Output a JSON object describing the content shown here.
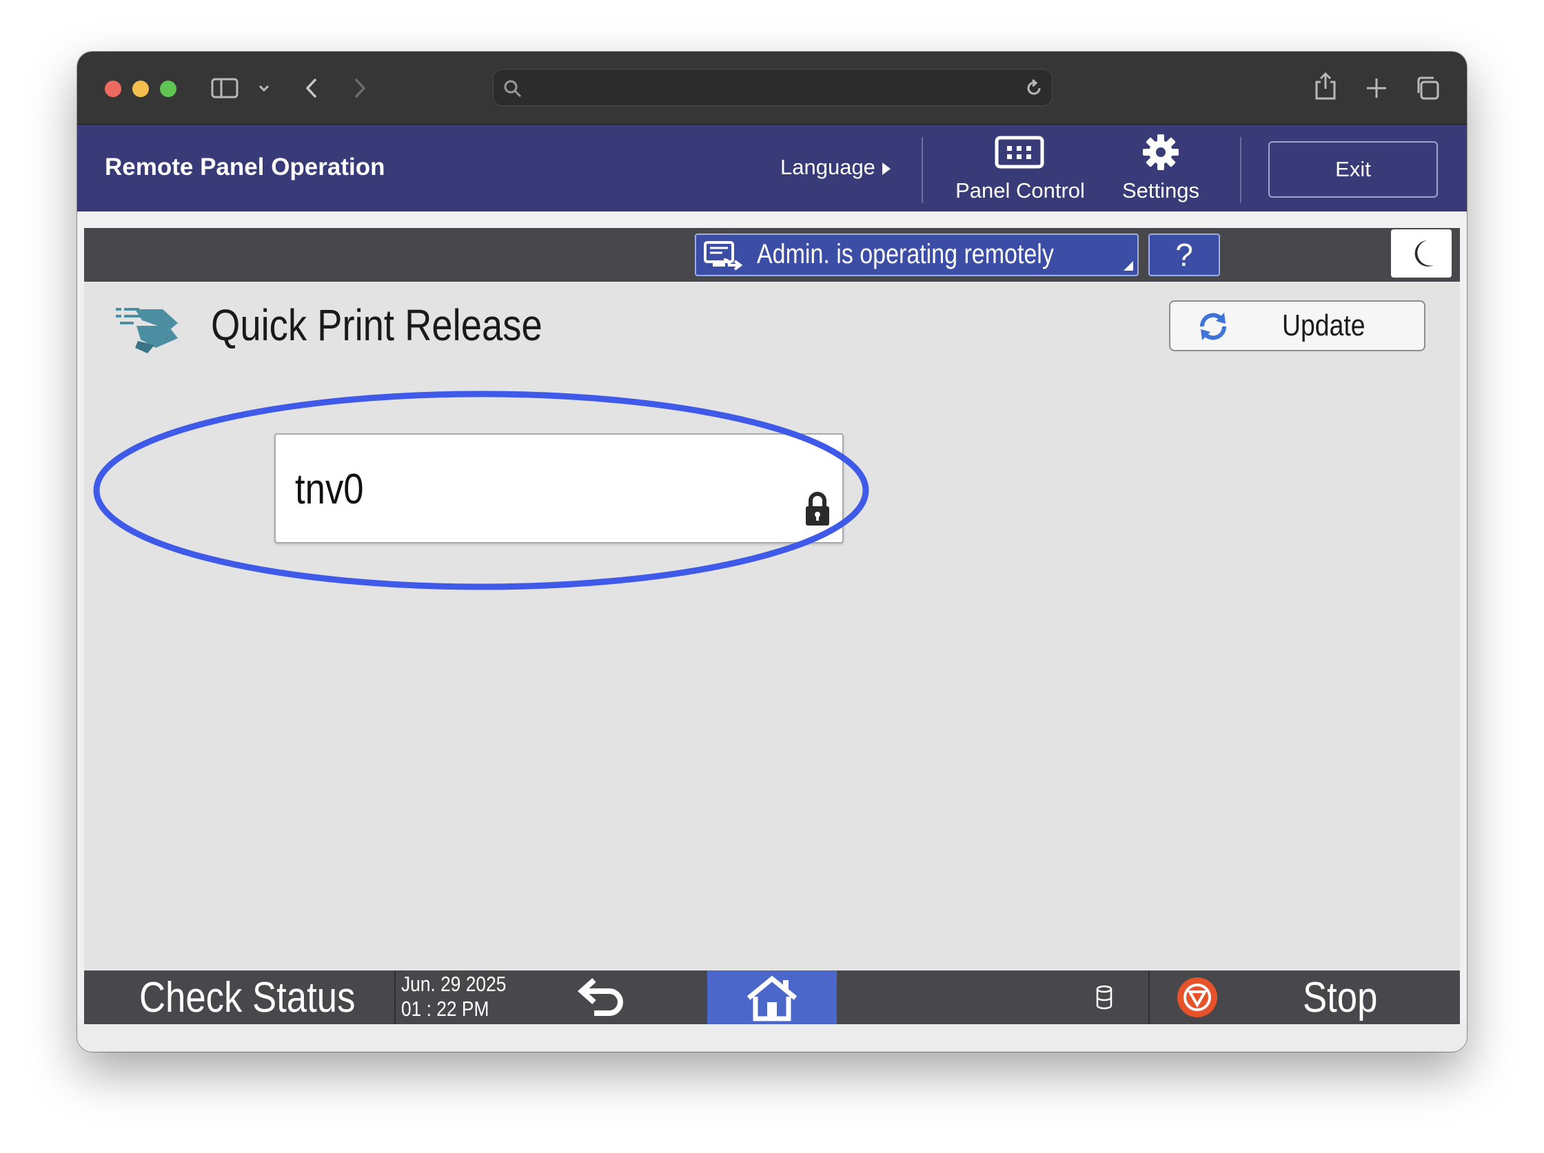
{
  "browser": {
    "icons": [
      "sidebar-icon",
      "chevron-down-icon",
      "back-icon",
      "forward-icon",
      "search-icon",
      "reload-icon",
      "share-icon",
      "new-tab-icon",
      "tabs-icon"
    ]
  },
  "header": {
    "title": "Remote Panel Operation",
    "language_label": "Language",
    "panel_control_label": "Panel Control",
    "settings_label": "Settings",
    "exit_label": "Exit"
  },
  "status": {
    "admin_text": "Admin. is operating remotely",
    "help_label": "?"
  },
  "main": {
    "title": "Quick Print Release",
    "update_label": "Update",
    "user_tile": {
      "name": "tnv0",
      "locked": true
    }
  },
  "bottom": {
    "check_status_label": "Check Status",
    "date": "Jun. 29 2025",
    "time": "01 : 22 PM",
    "stop_label": "Stop"
  },
  "colors": {
    "header_bg": "#393b79",
    "accent_blue": "#3c4da5",
    "home_blue": "#4a67c9",
    "highlight_ellipse": "#3f5ae8",
    "stop_red": "#e6532b"
  }
}
